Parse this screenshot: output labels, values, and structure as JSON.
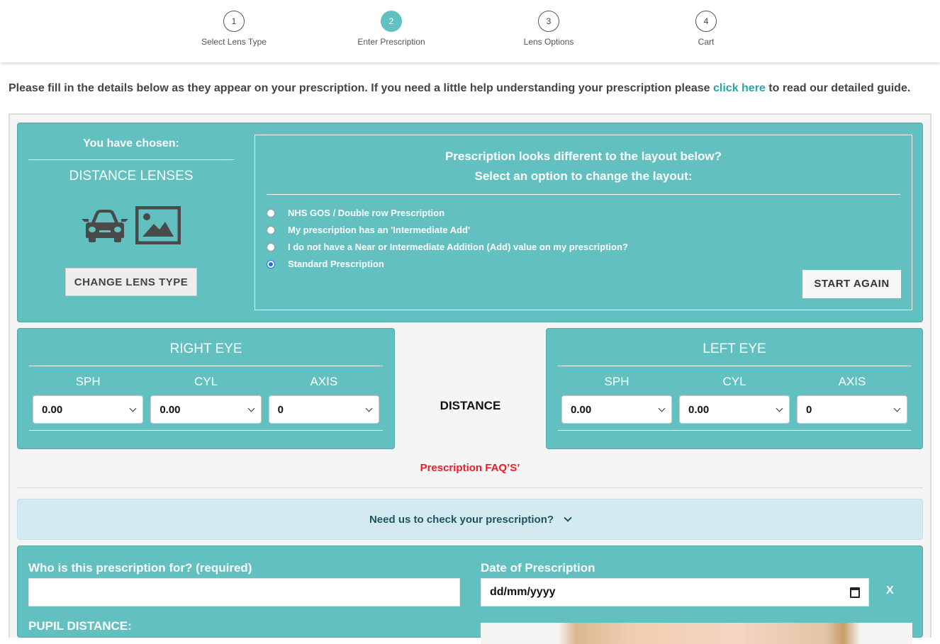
{
  "stepper": {
    "steps": [
      {
        "number": "1",
        "label": "Select Lens Type",
        "active": false
      },
      {
        "number": "2",
        "label": "Enter Prescription",
        "active": true
      },
      {
        "number": "3",
        "label": "Lens Options",
        "active": false
      },
      {
        "number": "4",
        "label": "Cart",
        "active": false
      }
    ]
  },
  "intro": {
    "text_before": "Please fill in the details below as they appear on your prescription. If you need a little help understanding your prescription please ",
    "link_label": "click here",
    "text_after": " to read our detailed guide."
  },
  "chosen": {
    "title": "You have chosen:",
    "lens_type": "DISTANCE LENSES",
    "icons": [
      "car-icon",
      "image-icon"
    ],
    "change_button": "CHANGE LENS TYPE"
  },
  "layout": {
    "question_line1": "Prescription looks different to the layout below?",
    "question_line2": "Select an option to change the layout:",
    "options": [
      {
        "label": "NHS GOS / Double row Prescription",
        "checked": false
      },
      {
        "label": "My prescription has an 'Intermediate Add'",
        "checked": false
      },
      {
        "label": "I do not have a Near or Intermediate Addition (Add) value on my prescription?",
        "checked": false
      },
      {
        "label": "Standard Prescription",
        "checked": true
      }
    ],
    "start_again_button": "START AGAIN"
  },
  "right_eye": {
    "title": "RIGHT EYE",
    "fields": [
      {
        "label": "SPH",
        "value": "0.00"
      },
      {
        "label": "CYL",
        "value": "0.00"
      },
      {
        "label": "AXIS",
        "value": "0"
      }
    ]
  },
  "row_label": "DISTANCE",
  "left_eye": {
    "title": "LEFT EYE",
    "fields": [
      {
        "label": "SPH",
        "value": "0.00"
      },
      {
        "label": "CYL",
        "value": "0.00"
      },
      {
        "label": "AXIS",
        "value": "0"
      }
    ]
  },
  "faq_link": "Prescription FAQ’S’",
  "check_prescription": "Need us to check your prescription?",
  "form": {
    "who_label": "Who is this prescription for? (required)",
    "who_value": "",
    "date_label": "Date of Prescription",
    "date_placeholder": "dd/mm/yyyy",
    "clear_button": "X",
    "pupil_label": "PUPIL DISTANCE:"
  },
  "colors": {
    "accent": "#62c1c0",
    "link": "#2aa5a4",
    "faq": "#ee1c25",
    "info_bg": "#d3ebf0"
  }
}
